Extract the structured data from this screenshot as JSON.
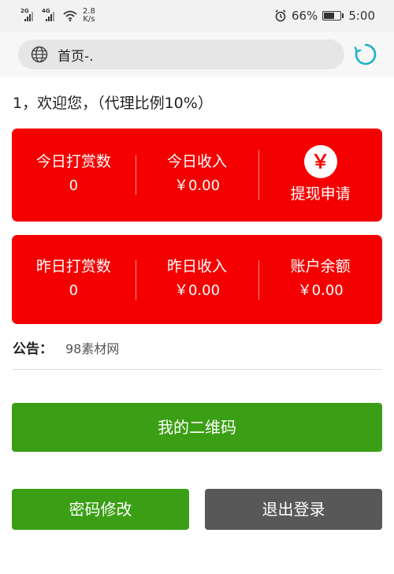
{
  "status_bar": {
    "net1_tag": "2G",
    "net2_tag": "4G",
    "speed_value": "2.8",
    "speed_unit": "K/s",
    "battery_percent": "66%",
    "battery_level": 0.66,
    "time": "5:00"
  },
  "browser": {
    "url_text": "首页-.",
    "icons": {
      "globe": "globe-icon",
      "refresh": "refresh-icon"
    },
    "accent": "#1ab3c8"
  },
  "welcome": "1，欢迎您，（代理比例10%）",
  "today_stats": {
    "tip_count_label": "今日打赏数",
    "tip_count_value": "0",
    "income_label": "今日收入",
    "income_value": "￥0.00",
    "withdraw_symbol": "￥",
    "withdraw_label": "提现申请"
  },
  "yesterday_stats": {
    "tip_count_label": "昨日打赏数",
    "tip_count_value": "0",
    "income_label": "昨日收入",
    "income_value": "￥0.00",
    "balance_label": "账户余额",
    "balance_value": "￥0.00"
  },
  "notice": {
    "label": "公告：",
    "text": "98素材网"
  },
  "buttons": {
    "qr_code": "我的二维码",
    "change_password": "密码修改",
    "logout": "退出登录"
  },
  "colors": {
    "card_red": "#f50000",
    "primary_green": "#3b9f15",
    "logout_gray": "#585858"
  }
}
